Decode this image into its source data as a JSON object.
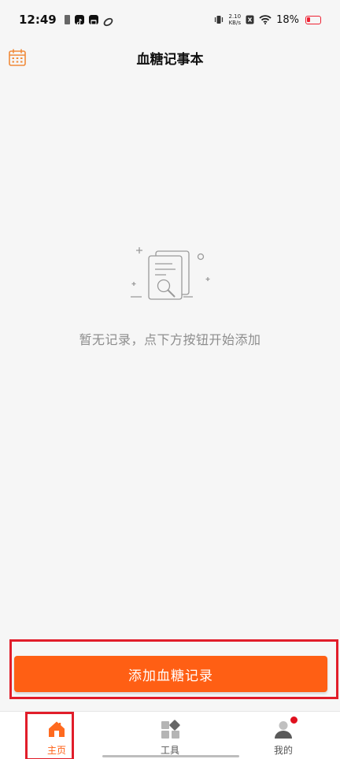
{
  "status_bar": {
    "time": "12:49",
    "net_speed_value": "2.10",
    "net_speed_unit": "KB/s",
    "battery_percent": "18%"
  },
  "header": {
    "title": "血糖记事本",
    "left_icon": "calendar-icon"
  },
  "empty_state": {
    "icon": "document-search-icon",
    "message": "暂无记录，点下方按钮开始添加"
  },
  "actions": {
    "add_button_label": "添加血糖记录"
  },
  "tab_bar": {
    "tabs": [
      {
        "label": "主页",
        "icon": "home-icon",
        "active": true
      },
      {
        "label": "工具",
        "icon": "tools-grid-icon",
        "active": false
      },
      {
        "label": "我的",
        "icon": "profile-icon",
        "active": false,
        "badge": true
      }
    ]
  },
  "colors": {
    "accent": "#ff5f14",
    "background": "#f6f6f6",
    "annotation": "#e11d2a"
  }
}
